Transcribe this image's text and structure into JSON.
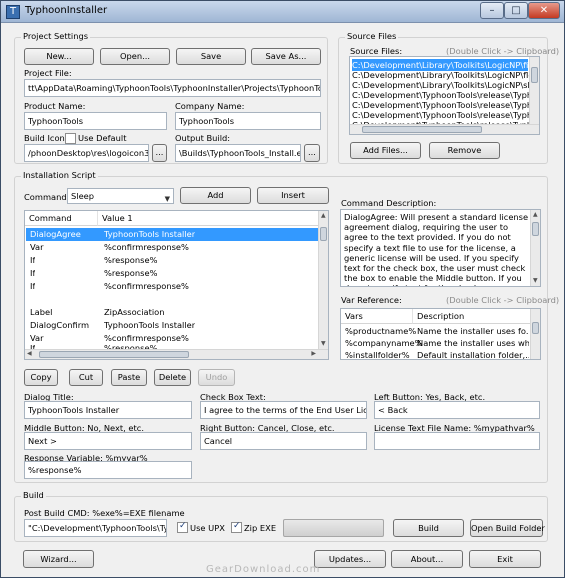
{
  "window": {
    "title": "TyphoonInstaller",
    "controls": [
      "–",
      "□",
      "✕"
    ]
  },
  "project": {
    "group_title": "Project Settings",
    "buttons": {
      "new": "New...",
      "open": "Open...",
      "save": "Save",
      "save_as": "Save As..."
    },
    "file_label": "Project File:",
    "file_value": "tt\\AppData\\Roaming\\TyphoonTools\\TyphoonInstaller\\Projects\\TyphoonTools.tip",
    "product_label": "Product Name:",
    "product_value": "TyphoonTools",
    "company_label": "Company Name:",
    "company_value": "TyphoonTools",
    "icon_label": "Build Icon:",
    "use_default_label": "Use Default",
    "icon_value": "/phoonDesktop\\res\\logoicon3.ico",
    "output_label": "Output Build:",
    "output_value": "\\Builds\\TyphoonTools_Install.exe",
    "browse": "..."
  },
  "source": {
    "group_title": "Source Files",
    "files_label": "Source Files:",
    "hint": "(Double Click -> Clipboard)",
    "files": [
      "C:\\Development\\Library\\Toolkits\\LogicNP\\filevw5",
      "C:\\Development\\Library\\Toolkits\\LogicNP\\fldrvw5",
      "C:\\Development\\Library\\Toolkits\\LogicNP\\shlvw5",
      "C:\\Development\\TyphoonTools\\release\\Typhoo",
      "C:\\Development\\TyphoonTools\\release\\Typhoo",
      "C:\\Development\\TyphoonTools\\release\\Typhoo",
      "C:\\Development\\TyphoonTools\\release\\Typhoo",
      "C:\\Development\\TyphoonTools\\release\\Typhoo"
    ],
    "add_files": "Add Files...",
    "remove": "Remove"
  },
  "script": {
    "group_title": "Installation Script",
    "command_label": "Command:",
    "command_value": "Sleep",
    "add": "Add",
    "insert": "Insert",
    "col_command": "Command",
    "col_value": "Value 1",
    "rows": [
      {
        "command": "DialogAgree",
        "value": "TyphoonTools Installer"
      },
      {
        "command": "Var",
        "value": "%confirmresponse%"
      },
      {
        "command": "If",
        "value": "%response%"
      },
      {
        "command": "If",
        "value": "%response%"
      },
      {
        "command": "If",
        "value": "%confirmresponse%"
      },
      {
        "command": "",
        "value": ""
      },
      {
        "command": "Label",
        "value": "ZipAssociation"
      },
      {
        "command": "DialogConfirm",
        "value": "TyphoonTools Installer"
      },
      {
        "command": "Var",
        "value": "%confirmresponse%"
      },
      {
        "command": "If",
        "value": "%response%"
      }
    ],
    "copy": "Copy",
    "cut": "Cut",
    "paste": "Paste",
    "delete": "Delete",
    "undo": "Undo",
    "desc_label": "Command Description:",
    "description": "DialogAgree: Will present a standard license agreement dialog, requiring the user to agree to the text provided.  If you do not specify a text file to use for the license, a generic license will be used.  If you specify text for the check box, the user must check the box to enable the Middle button.  If you do not specify text for the check",
    "var_label": "Var Reference:",
    "var_hint": "(Double Click -> Clipboard)",
    "var_col_vars": "Vars",
    "var_col_desc": "Description",
    "vars": [
      {
        "name": "%productname%",
        "desc": "Name the installer uses fo..."
      },
      {
        "name": "%companyname%",
        "desc": "Name the installer uses when ..."
      },
      {
        "name": "%installfolder%",
        "desc": "Default installation folder,..."
      }
    ]
  },
  "dialog": {
    "title_label": "Dialog Title:",
    "title_value": "TyphoonTools Installer",
    "check_label": "Check Box Text:",
    "check_value": "I agree to the terms of the End User License",
    "left_label": "Left Button: Yes, Back, etc.",
    "left_value": "< Back",
    "middle_label": "Middle Button: No, Next, etc.",
    "middle_value": "Next >",
    "right_label": "Right Button: Cancel, Close, etc.",
    "right_value": "Cancel",
    "license_label": "License Text File Name: %mypathvar%",
    "license_value": "",
    "response_label": "Response Variable: %myvar%",
    "response_value": "%response%"
  },
  "build": {
    "group_title": "Build",
    "post_label": "Post Build CMD: %exe%=EXE filename",
    "post_value": "\"C:\\Development\\TyphoonTools\\Typho",
    "use_upx": "Use UPX",
    "zip_exe": "Zip EXE",
    "build": "Build",
    "open_folder": "Open Build Folder"
  },
  "footer": {
    "wizard": "Wizard...",
    "updates": "Updates...",
    "about": "About...",
    "exit": "Exit"
  },
  "watermark": "GearDownload.com"
}
